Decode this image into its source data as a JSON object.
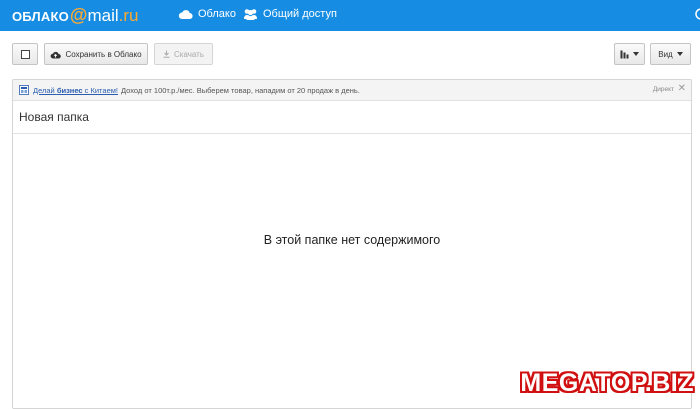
{
  "header": {
    "logo": {
      "part1": "ОБЛАКО",
      "at": "@",
      "part2": "mail",
      "part3": ".ru"
    },
    "nav": [
      {
        "label": "Облако",
        "icon": "cloud-icon"
      },
      {
        "label": "Общий доступ",
        "icon": "users-icon"
      }
    ]
  },
  "toolbar": {
    "select_all_icon": "checkbox-icon",
    "save_label": "Сохранить в Облако",
    "download_label": "Скачать",
    "sort_icon": "sort-icon",
    "view_label": "Вид"
  },
  "ad": {
    "link_prefix": "Делай ",
    "link_bold": "бизнес",
    "link_suffix": " с Китаем!",
    "text": "Доход от 100т.р./мес. Выберем товар, нападим от 20 продаж в день.",
    "source": "Директ",
    "close": "✕"
  },
  "folder": {
    "title": "Новая папка",
    "empty_message": "В этой папке нет содержимого"
  },
  "watermark": "MEGATOP.BIZ",
  "colors": {
    "header_bg": "#168de2",
    "logo_accent": "#ffa930",
    "watermark": "#d01010"
  }
}
